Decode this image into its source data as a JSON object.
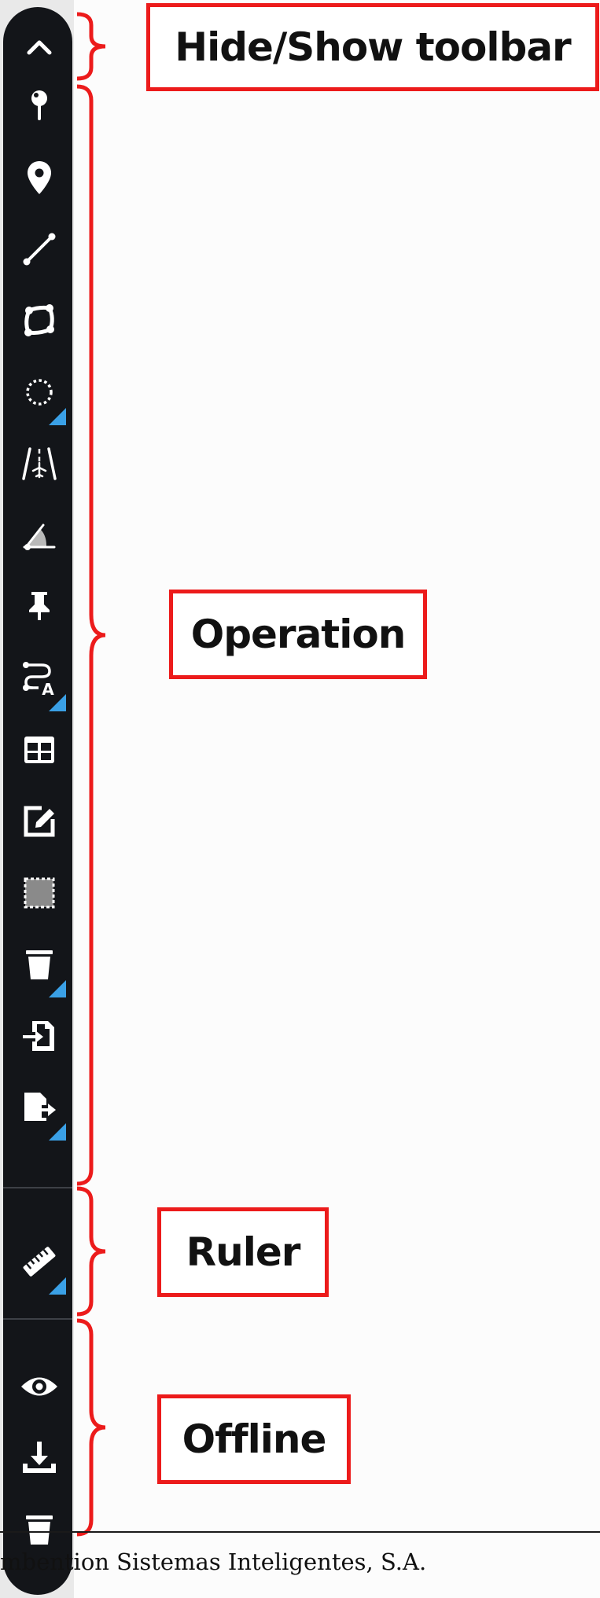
{
  "labels": {
    "hide_show_toolbar": "Hide/Show toolbar",
    "operation": "Operation",
    "ruler": "Ruler",
    "offline": "Offline"
  },
  "footer": {
    "text": "mbention Sistemas Inteligentes, S.A."
  },
  "toolbar": {
    "tools": [
      {
        "icon": "chevron-up-icon",
        "has_submenu": false
      },
      {
        "icon": "pin-point-icon",
        "has_submenu": false
      },
      {
        "icon": "map-marker-icon",
        "has_submenu": false
      },
      {
        "icon": "line-icon",
        "has_submenu": false
      },
      {
        "icon": "polygon-icon",
        "has_submenu": false
      },
      {
        "icon": "dotted-circle-icon",
        "has_submenu": true
      },
      {
        "icon": "runway-icon",
        "has_submenu": false
      },
      {
        "icon": "angle-icon",
        "has_submenu": false
      },
      {
        "icon": "pushpin-icon",
        "has_submenu": false
      },
      {
        "icon": "route-label-icon",
        "has_submenu": true
      },
      {
        "icon": "table-icon",
        "has_submenu": false
      },
      {
        "icon": "edit-icon",
        "has_submenu": false
      },
      {
        "icon": "select-area-icon",
        "has_submenu": false
      },
      {
        "icon": "trash-icon",
        "has_submenu": true
      },
      {
        "icon": "import-icon",
        "has_submenu": false
      },
      {
        "icon": "export-icon",
        "has_submenu": true
      },
      {
        "icon": "ruler-icon",
        "has_submenu": true
      },
      {
        "icon": "eye-icon",
        "has_submenu": false
      },
      {
        "icon": "download-icon",
        "has_submenu": false
      },
      {
        "icon": "trash-icon",
        "has_submenu": false
      }
    ]
  },
  "colors": {
    "toolbar_bg": "#131519",
    "icon": "#ffffff",
    "submenu_indicator": "#3aa0e6",
    "annotation_red": "#ec1b1b"
  }
}
